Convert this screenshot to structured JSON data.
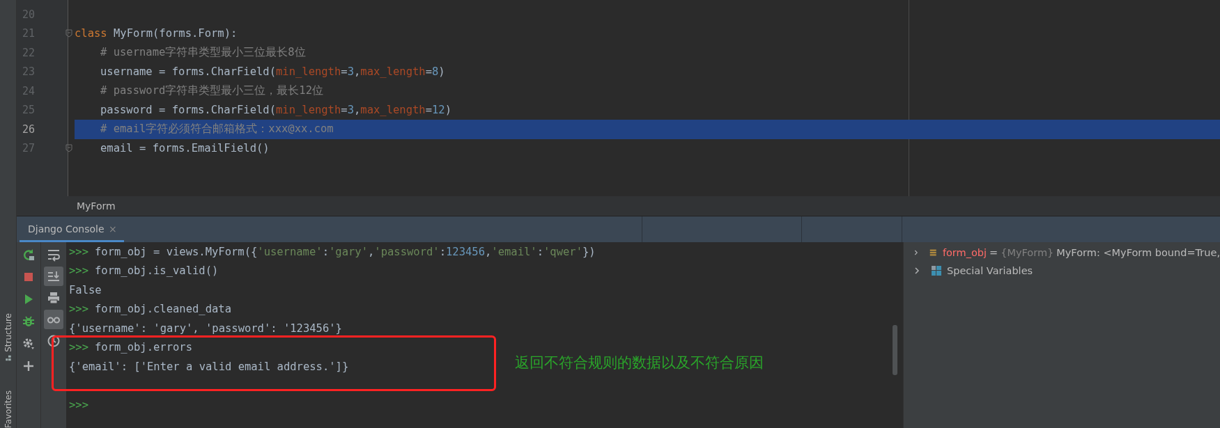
{
  "side_stripe": [
    {
      "label": "Structure"
    },
    {
      "label": "Favorites"
    }
  ],
  "editor": {
    "lines": [
      {
        "number": "20",
        "selected": false
      },
      {
        "number": "21",
        "selected": false,
        "indented": false,
        "fold": true,
        "tokens": [
          {
            "kind": "keyword",
            "text": "class"
          },
          {
            "kind": "plain",
            "text": " MyForm(forms.Form):"
          }
        ]
      },
      {
        "number": "22",
        "selected": false,
        "indented": true,
        "fold": false,
        "tokens": [
          {
            "kind": "comment",
            "text": "# username字符串类型最小三位最长8位"
          }
        ]
      },
      {
        "number": "23",
        "selected": false,
        "indented": true,
        "fold": false,
        "tokens": [
          {
            "kind": "plain",
            "text": "username = forms.CharField("
          },
          {
            "kind": "param",
            "text": "min_length"
          },
          {
            "kind": "plain",
            "text": "="
          },
          {
            "kind": "number",
            "text": "3"
          },
          {
            "kind": "plain",
            "text": ","
          },
          {
            "kind": "param",
            "text": "max_length"
          },
          {
            "kind": "plain",
            "text": "="
          },
          {
            "kind": "number",
            "text": "8"
          },
          {
            "kind": "plain",
            "text": ")"
          }
        ]
      },
      {
        "number": "24",
        "selected": false,
        "indented": true,
        "fold": false,
        "tokens": [
          {
            "kind": "comment",
            "text": "# password字符串类型最小三位，最长12位"
          }
        ]
      },
      {
        "number": "25",
        "selected": false,
        "indented": true,
        "fold": false,
        "tokens": [
          {
            "kind": "plain",
            "text": "password = forms.CharField("
          },
          {
            "kind": "param",
            "text": "min_length"
          },
          {
            "kind": "plain",
            "text": "="
          },
          {
            "kind": "number",
            "text": "3"
          },
          {
            "kind": "plain",
            "text": ","
          },
          {
            "kind": "param",
            "text": "max_length"
          },
          {
            "kind": "plain",
            "text": "="
          },
          {
            "kind": "number",
            "text": "12"
          },
          {
            "kind": "plain",
            "text": ")"
          }
        ]
      },
      {
        "number": "26",
        "selected": true,
        "indented": true,
        "fold": false,
        "tokens": [
          {
            "kind": "comment",
            "text": "# email字符必须符合邮箱格式：xxx@xx.com"
          }
        ]
      },
      {
        "number": "27",
        "selected": false,
        "indented": true,
        "fold": true,
        "tokens": [
          {
            "kind": "plain",
            "text": "email = forms.EmailField()"
          }
        ]
      }
    ]
  },
  "breadcrumb": "MyForm",
  "console_tab": {
    "label": "Django Console",
    "close": "×",
    "selected": true
  },
  "run_toolbar": [
    {
      "kind": "rerun"
    },
    {
      "kind": "stop"
    },
    {
      "kind": "run"
    },
    {
      "kind": "debug"
    },
    {
      "kind": "settings"
    },
    {
      "kind": "add"
    }
  ],
  "view_toolbar": [
    {
      "kind": "wrap",
      "on": false
    },
    {
      "kind": "scroll-end",
      "on": true
    },
    {
      "kind": "print",
      "on": false
    },
    {
      "kind": "glasses",
      "on": true
    },
    {
      "kind": "history",
      "on": false
    }
  ],
  "console_lines": [
    {
      "kind": "input",
      "prompt": ">>>",
      "tokens": [
        {
          "kind": "plain",
          "text": "form_obj = views.MyForm({"
        },
        {
          "kind": "string",
          "text": "'username'"
        },
        {
          "kind": "plain",
          "text": ":"
        },
        {
          "kind": "string",
          "text": "'gary'"
        },
        {
          "kind": "plain",
          "text": ","
        },
        {
          "kind": "string",
          "text": "'password'"
        },
        {
          "kind": "plain",
          "text": ":"
        },
        {
          "kind": "number",
          "text": "123456"
        },
        {
          "kind": "plain",
          "text": ","
        },
        {
          "kind": "string",
          "text": "'email'"
        },
        {
          "kind": "plain",
          "text": ":"
        },
        {
          "kind": "string",
          "text": "'qwer'"
        },
        {
          "kind": "plain",
          "text": "})"
        }
      ]
    },
    {
      "kind": "input",
      "prompt": ">>>",
      "tokens": [
        {
          "kind": "plain",
          "text": "form_obj.is_valid()"
        }
      ]
    },
    {
      "kind": "output",
      "tokens": [
        {
          "kind": "plain",
          "text": "False"
        }
      ]
    },
    {
      "kind": "input",
      "prompt": ">>>",
      "tokens": [
        {
          "kind": "plain",
          "text": "form_obj.cleaned_data"
        }
      ]
    },
    {
      "kind": "output",
      "tokens": [
        {
          "kind": "plain",
          "text": "{'username': 'gary', 'password': '123456'}"
        }
      ]
    },
    {
      "kind": "input",
      "prompt": ">>>",
      "tokens": [
        {
          "kind": "plain",
          "text": "form_obj.errors"
        }
      ]
    },
    {
      "kind": "output",
      "tokens": [
        {
          "kind": "plain",
          "text": "{'email': ['Enter a valid email address.']}"
        }
      ]
    },
    {
      "kind": "blank"
    },
    {
      "kind": "input",
      "prompt": ">>>"
    }
  ],
  "annotation": {
    "text": "返回不符合规则的数据以及不符合原因"
  },
  "variables": [
    {
      "kind": "object",
      "expanded": false,
      "name": "form_obj",
      "equals": "=",
      "type": "{MyForm}",
      "value": "MyForm: <MyForm bound=True,"
    },
    {
      "kind": "special",
      "expanded": false,
      "name": "Special Variables"
    }
  ]
}
